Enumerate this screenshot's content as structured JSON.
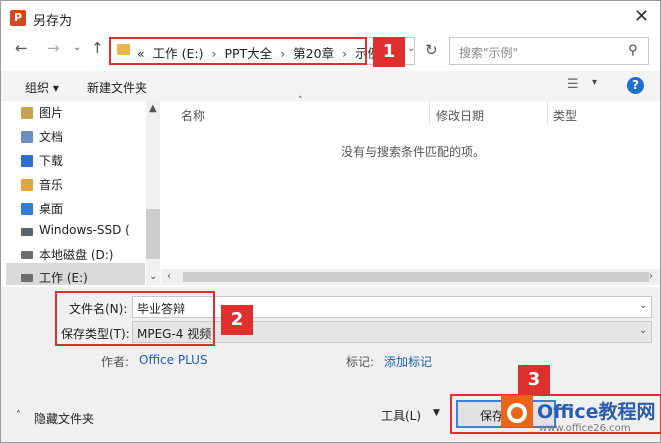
{
  "window": {
    "title": "另存为",
    "app_icon_letter": "P"
  },
  "address": {
    "crumbs": [
      "工作 (E:)",
      "PPT大全",
      "第20章",
      "示例"
    ],
    "prefix": "«",
    "separator": "›",
    "search_placeholder": "搜索\"示例\""
  },
  "badges": [
    "1",
    "2",
    "3"
  ],
  "toolbar": {
    "organize_label": "组织 ▾",
    "new_folder_label": "新建文件夹",
    "view_label": "▾",
    "help_label": "?"
  },
  "nav_pane": {
    "items": [
      {
        "label": "图片",
        "color": "#c9a24a"
      },
      {
        "label": "文档",
        "color": "#6a8fc0"
      },
      {
        "label": "下载",
        "color": "#2f6fcf"
      },
      {
        "label": "音乐",
        "color": "#e6a23c"
      },
      {
        "label": "桌面",
        "color": "#2f7fd6"
      },
      {
        "label": "Windows-SSD (",
        "color": "#5b6470"
      },
      {
        "label": "本地磁盘 (D:)",
        "color": "#6d6d6d"
      },
      {
        "label": "工作 (E:)",
        "color": "#6d6d6d"
      }
    ],
    "selected_index": 7
  },
  "file_list": {
    "columns": [
      "名称",
      "修改日期",
      "类型"
    ],
    "empty_message": "没有与搜索条件匹配的项。"
  },
  "form": {
    "filename_label": "文件名(N):",
    "filename_value": "毕业答辩",
    "filetype_label": "保存类型(T):",
    "filetype_value": "MPEG-4 视频",
    "author_label": "作者:",
    "author_value": "Office PLUS",
    "tags_label": "标记:",
    "tags_value": "添加标记"
  },
  "footer": {
    "hide_folders_label": "隐藏文件夹",
    "tools_label": "工具(L)",
    "save_label": "保存(S)"
  },
  "watermark": {
    "brand": "Office教程网",
    "url": "www.office26.com"
  },
  "colors": {
    "accent_red": "#e0302e",
    "link_blue": "#1f5fb4",
    "help_blue": "#1f6fd1"
  }
}
